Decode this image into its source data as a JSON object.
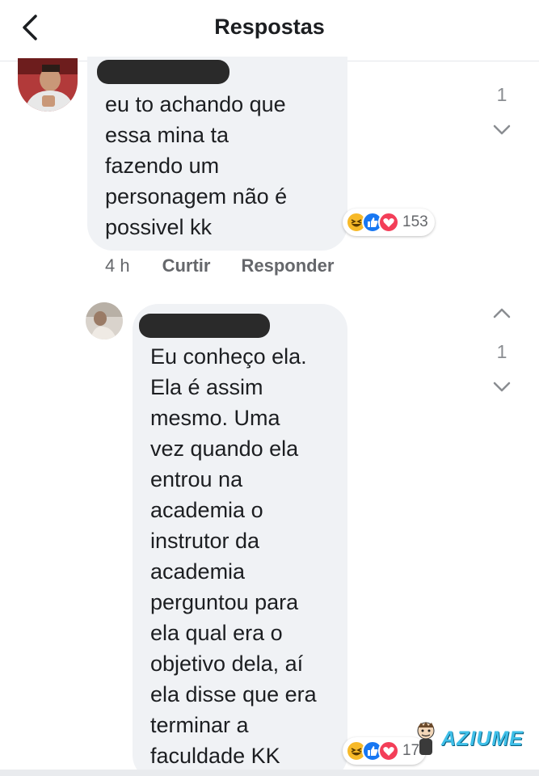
{
  "header": {
    "title": "Respostas",
    "back_icon": "chevron-left-icon"
  },
  "comments": [
    {
      "text": "eu to achando que\nessa mina ta\nfazendo um\npersonagem não é\npossivel kk",
      "reactions": {
        "icons": [
          "haha",
          "like",
          "love"
        ],
        "count": "153"
      },
      "time": "4 h",
      "like_label": "Curtir",
      "reply_label": "Responder",
      "votes": "1"
    },
    {
      "text": "Eu conheço ela.\nEla é assim\nmesmo. Uma\nvez quando ela\nentrou na\nacademia o\ninstrutor da\nacademia\nperguntou para\nela qual era o\nobjetivo dela, aí\nela disse que era\nterminar a\nfaculdade KK",
      "reactions": {
        "icons": [
          "haha",
          "like",
          "love"
        ],
        "count": "17"
      },
      "votes": "1"
    }
  ],
  "watermark": {
    "text": "AZIUME"
  },
  "colors": {
    "like": "#1877f2",
    "love": "#f33e58",
    "haha": "#f7b928",
    "bubble": "#f0f2f5"
  }
}
